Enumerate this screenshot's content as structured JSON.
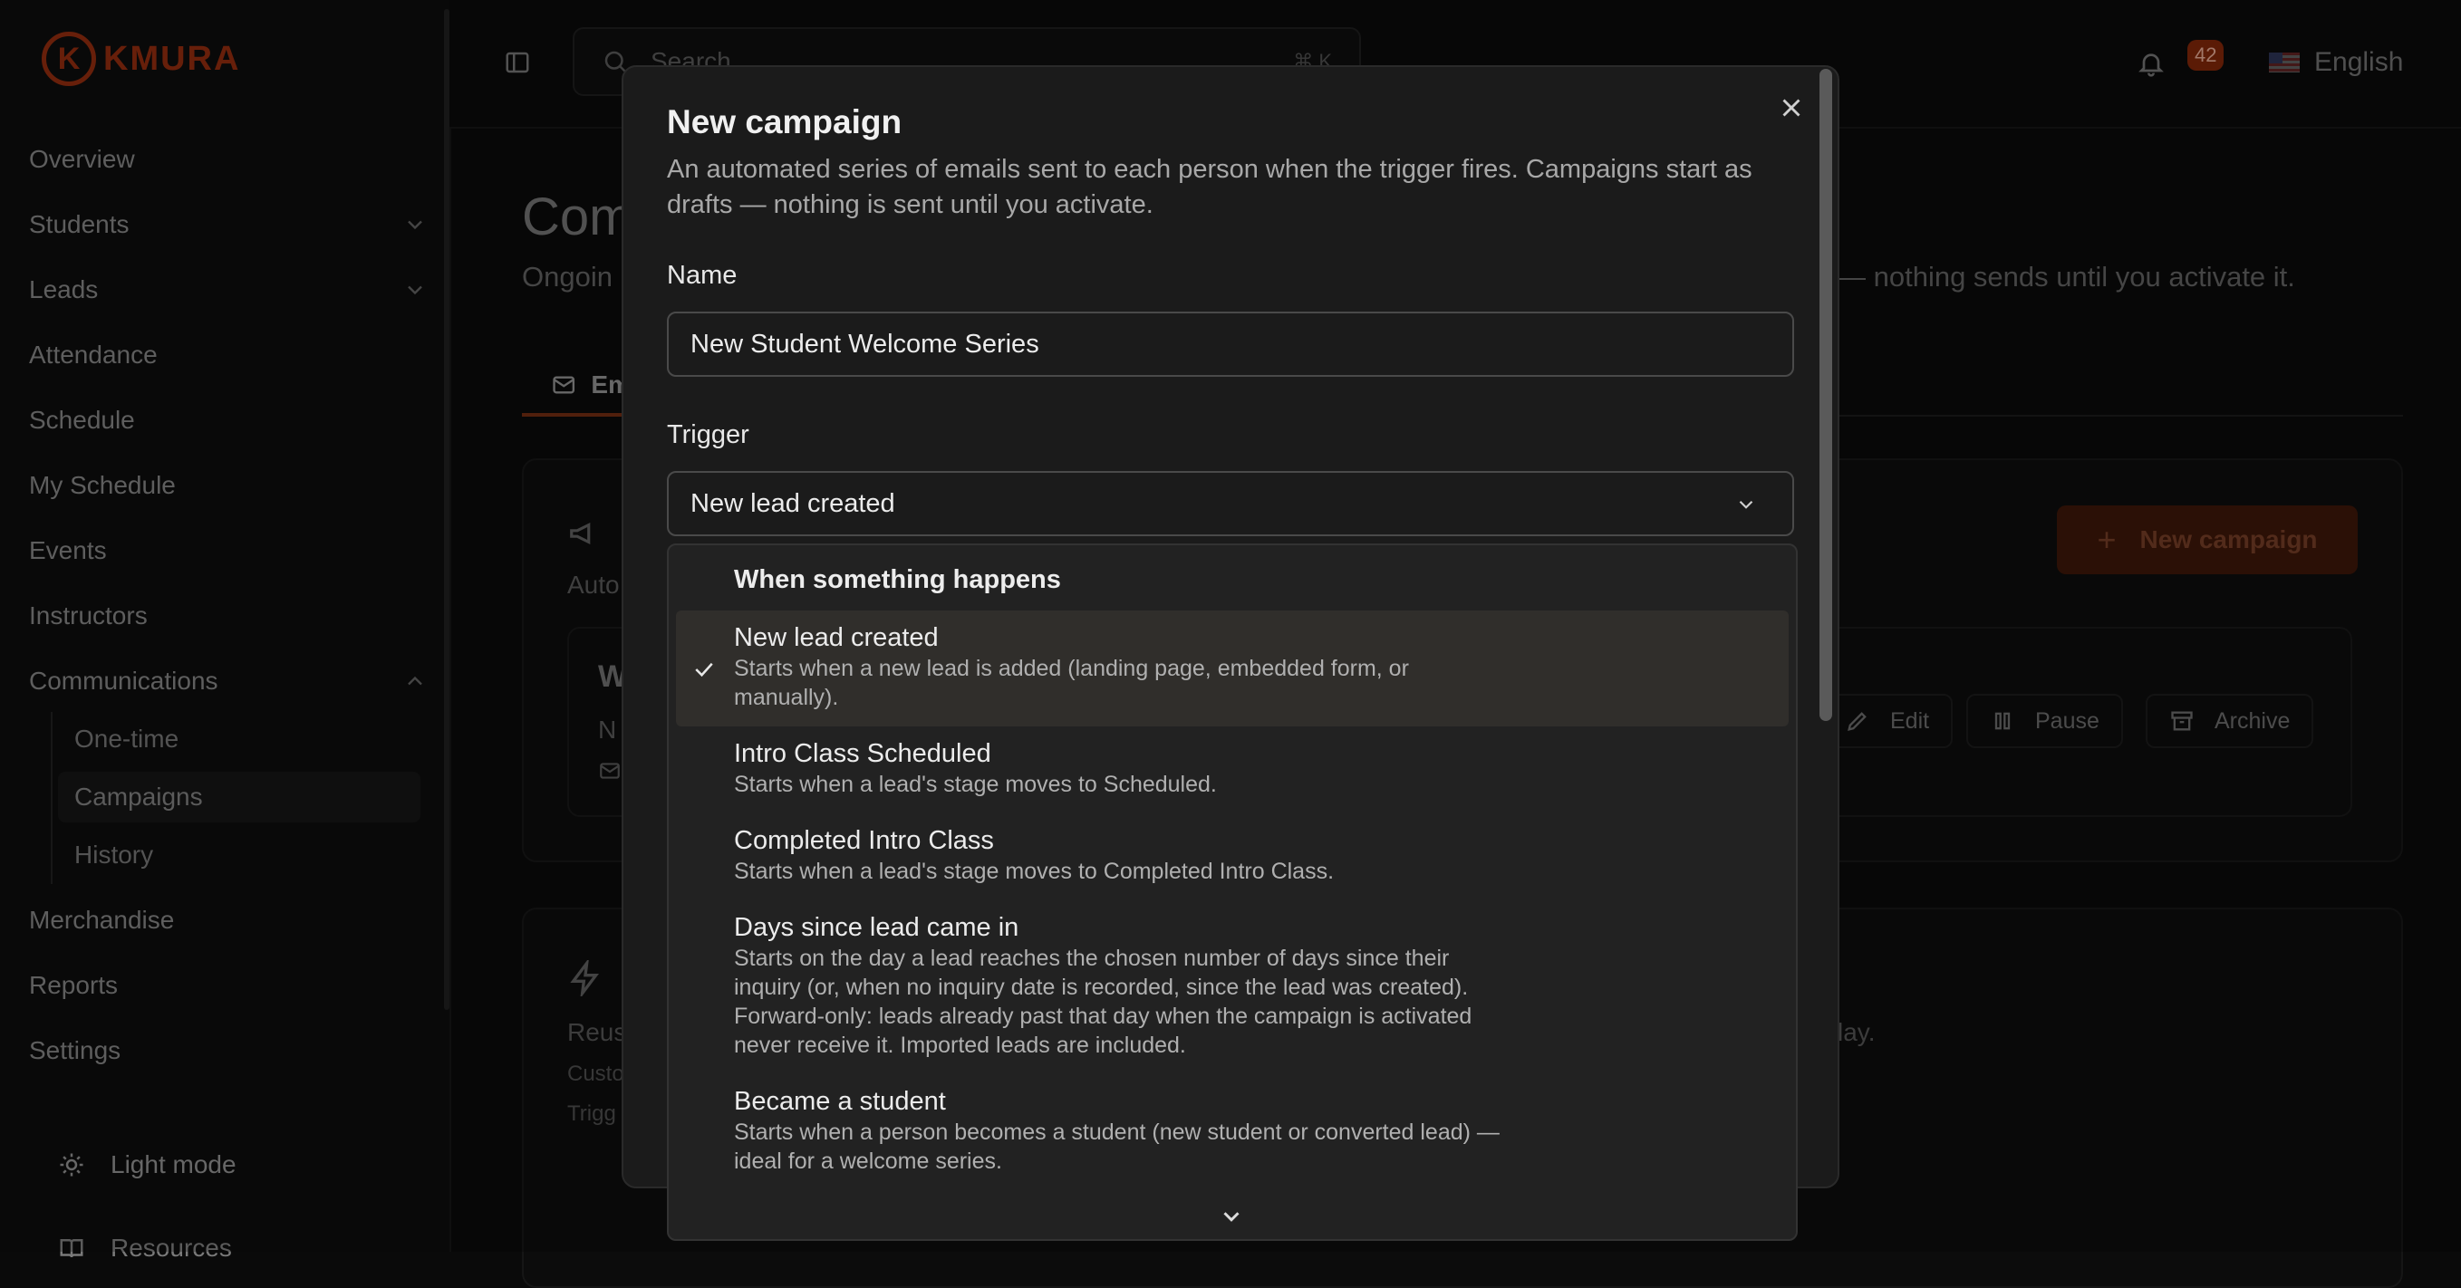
{
  "app": {
    "logo_letter": "K",
    "logo_text": "KMURA"
  },
  "sidebar": {
    "items": [
      {
        "label": "Overview"
      },
      {
        "label": "Students"
      },
      {
        "label": "Leads"
      },
      {
        "label": "Attendance"
      },
      {
        "label": "Schedule"
      },
      {
        "label": "My Schedule"
      },
      {
        "label": "Events"
      },
      {
        "label": "Instructors"
      },
      {
        "label": "Communications"
      },
      {
        "label": "Merchandise"
      },
      {
        "label": "Reports"
      },
      {
        "label": "Settings"
      }
    ],
    "sub_items": [
      {
        "label": "One-time"
      },
      {
        "label": "Campaigns"
      },
      {
        "label": "History"
      }
    ],
    "light_mode_label": "Light mode",
    "resources_label": "Resources"
  },
  "topbar": {
    "search_placeholder": "Search...",
    "search_shortcut": "⌘ K",
    "notification_count": "42",
    "language": "English"
  },
  "page": {
    "title": "Com",
    "subtitle_left": "Ongoin",
    "subtitle_right": "— nothing sends until you activate it.",
    "tab_label": "Em",
    "card1_desc": "Auto",
    "new_campaign_label": "New campaign",
    "inner_title": "W",
    "inner_sub": "N",
    "actions": {
      "edit": "Edit",
      "pause": "Pause",
      "archive": "Archive"
    },
    "card2_desc_left": "Reus",
    "card2_desc_right": "lay.",
    "card2_line1": "Custo",
    "card2_line2": "Trigg"
  },
  "modal": {
    "title": "New campaign",
    "description": "An automated series of emails sent to each person when the trigger fires. Campaigns start as drafts — nothing is sent until you activate.",
    "name_label": "Name",
    "name_value": "New Student Welcome Series",
    "trigger_label": "Trigger",
    "trigger_value": "New lead created"
  },
  "dropdown": {
    "heading": "When something happens",
    "options": [
      {
        "title": "New lead created",
        "desc": "Starts when a new lead is added (landing page, embedded form, or manually).",
        "selected": true
      },
      {
        "title": "Intro Class Scheduled",
        "desc": "Starts when a lead's stage moves to Scheduled."
      },
      {
        "title": "Completed Intro Class",
        "desc": "Starts when a lead's stage moves to Completed Intro Class."
      },
      {
        "title": "Days since lead came in",
        "desc": "Starts on the day a lead reaches the chosen number of days since their inquiry (or, when no inquiry date is recorded, since the lead was created). Forward-only: leads already past that day when the campaign is activated never receive it. Imported leads are included."
      },
      {
        "title": "Became a student",
        "desc": "Starts when a person becomes a student (new student or converted lead) — ideal for a welcome series."
      }
    ]
  },
  "colors": {
    "accent": "#8a2a0e",
    "modal_bg": "#1b1b1b",
    "dropdown_bg": "#222222",
    "selected_bg": "#302e2b"
  }
}
